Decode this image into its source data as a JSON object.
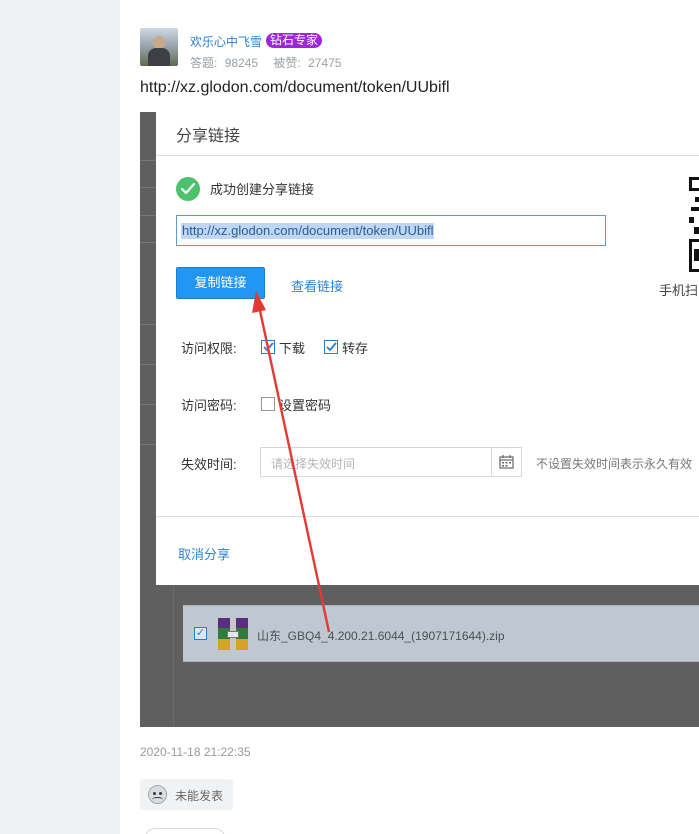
{
  "author": {
    "name": "欢乐心中飞雪",
    "badge": "钻石专家",
    "answers_label": "答题:",
    "answers_value": "98245",
    "likes_label": "被赞:",
    "likes_value": "27475"
  },
  "post": {
    "link_text": "http://xz.glodon.com/document/token/UUbifl",
    "timestamp": "2020-11-18 21:22:35",
    "reaction_label": "未能发表"
  },
  "dialog": {
    "title": "分享链接",
    "success_text": "成功创建分享链接",
    "link_value": "http://xz.glodon.com/document/token/UUbifl",
    "copy_button": "复制链接",
    "view_link": "查看链接",
    "qr_caption": "手机扫",
    "access_label": "访问权限:",
    "download_label": "下载",
    "download_checked": true,
    "save_label": "转存",
    "save_checked": true,
    "password_label": "访问密码:",
    "set_password_label": "设置密码",
    "set_password_checked": false,
    "expire_label": "失效时间:",
    "expire_placeholder": "请选择失效时间",
    "expire_hint": "不设置失效时间表示永久有效",
    "cancel_share": "取消分享"
  },
  "background_file": {
    "name": "山东_GBQ4_4.200.21.6044_(1907171644).zip",
    "checked": true
  },
  "colors": {
    "primary": "#2196f3",
    "link": "#2d84d8",
    "success": "#4cc36b",
    "badge": "#9b27d8",
    "annotation_arrow": "#e53935"
  },
  "icons": [
    "success-check-icon",
    "calendar-icon",
    "zip-file-icon",
    "qr-code-icon",
    "sad-emoji-icon",
    "checkbox-check-icon"
  ]
}
